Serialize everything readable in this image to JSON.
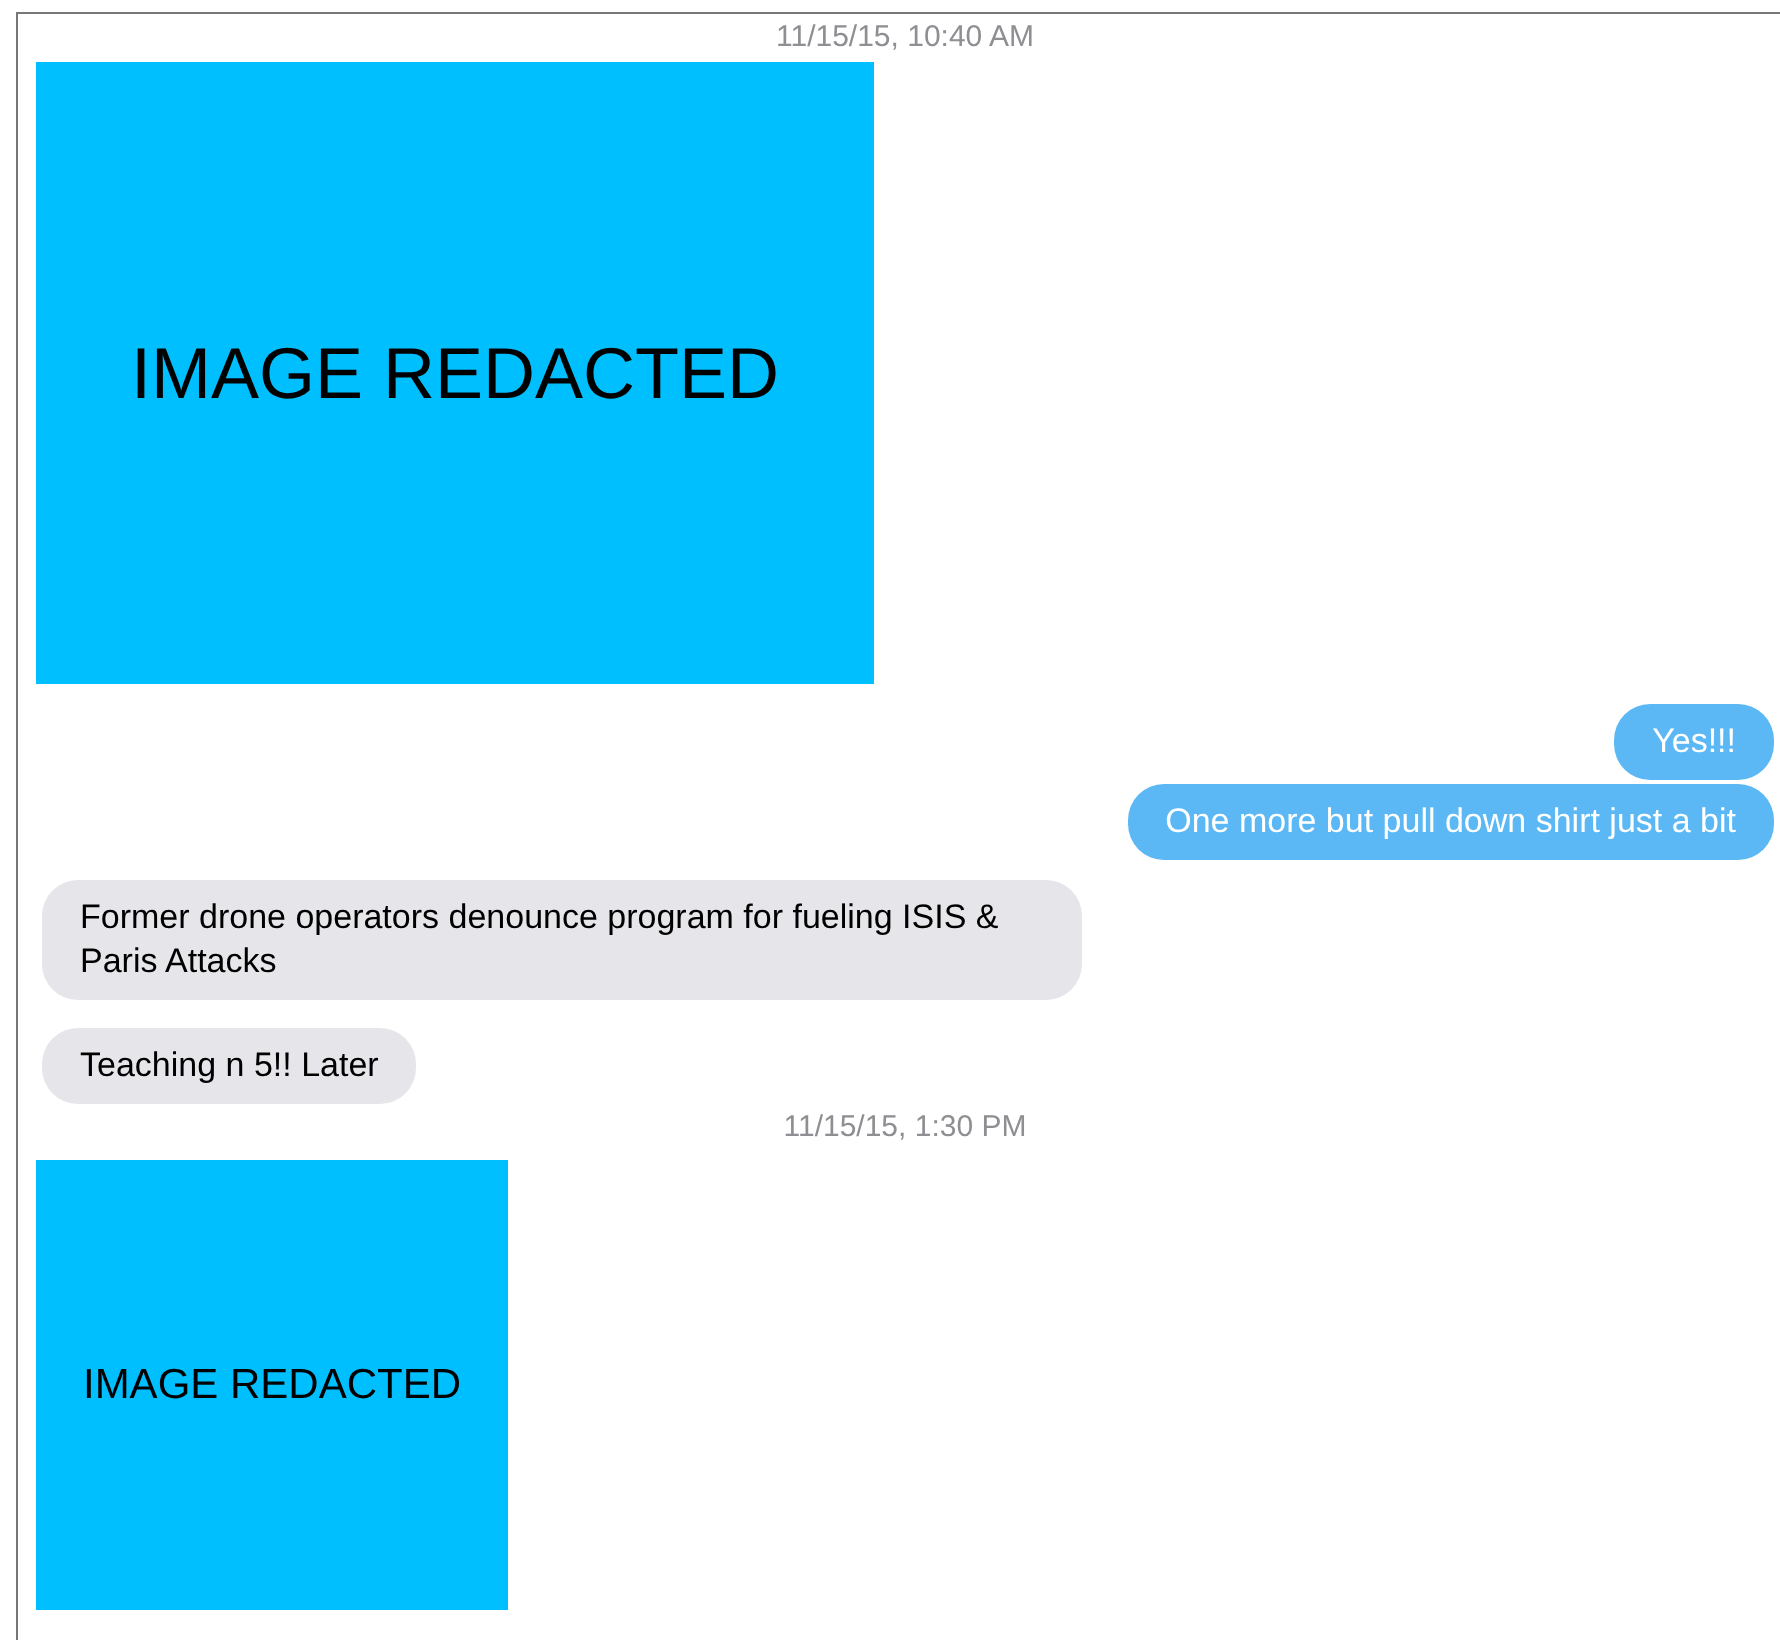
{
  "messages": [
    {
      "kind": "timestamp",
      "text": "11/15/15, 10:40 AM"
    },
    {
      "kind": "large_image",
      "text": "IMAGE REDACTED"
    },
    {
      "kind": "bubble",
      "sent": true,
      "text": "Yes!!!"
    },
    {
      "kind": "bubble",
      "sent": true,
      "text": "One more but pull down shirt just a bit"
    },
    {
      "kind": "bubble",
      "sent": false,
      "text": "Former drone operators denounce program for fueling ISIS & Paris Attacks"
    },
    {
      "kind": "bubble",
      "sent": false,
      "text": "Teaching n 5!! Later"
    },
    {
      "kind": "timestamp",
      "text": "11/15/15, 1:30 PM"
    },
    {
      "kind": "small_image",
      "text": "IMAGE REDACTED"
    }
  ]
}
